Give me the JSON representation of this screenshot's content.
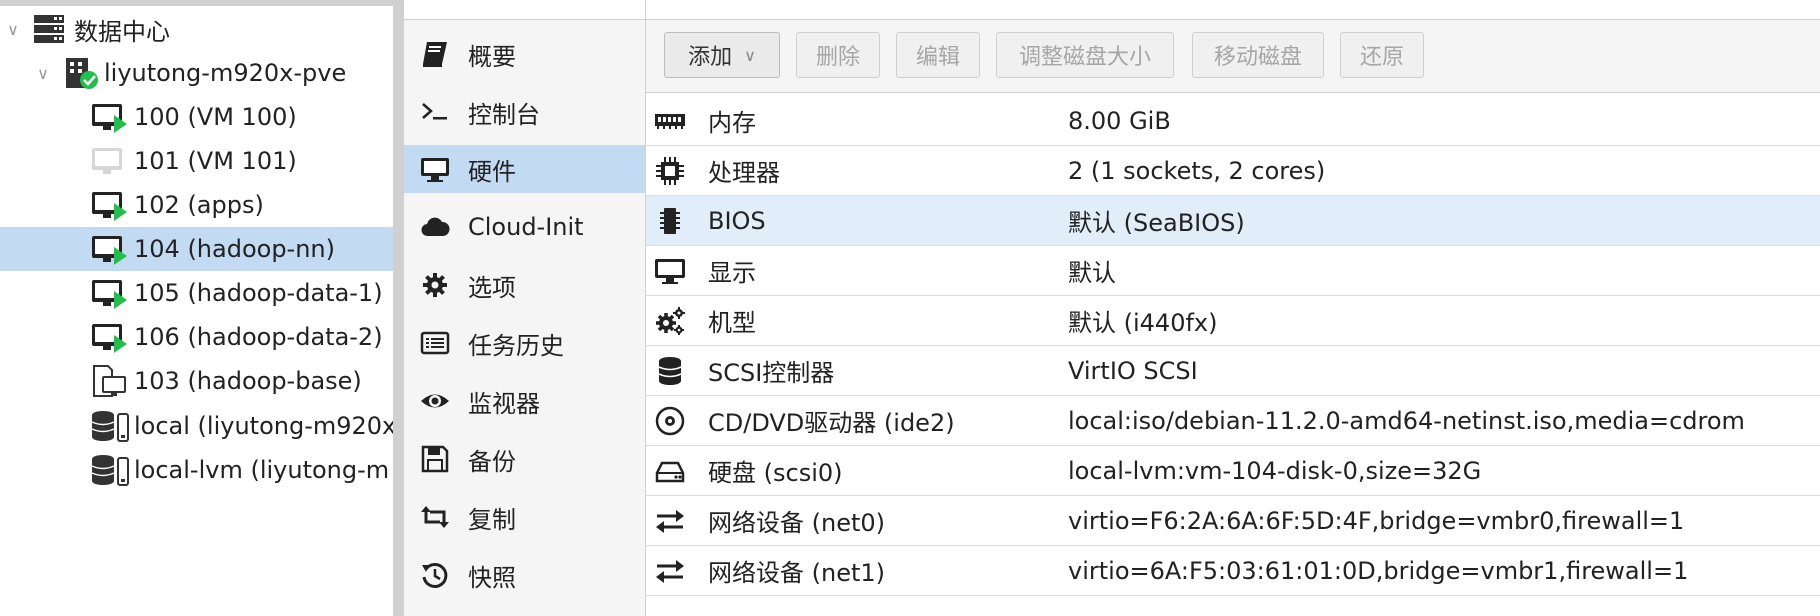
{
  "tree": {
    "items": [
      {
        "label": "数据中心",
        "icon": "datacenter-icon"
      },
      {
        "label": "liyutong-m920x-pve",
        "icon": "node-online-icon"
      },
      {
        "label": "100 (VM 100)",
        "icon": "vm-running-icon"
      },
      {
        "label": "101 (VM 101)",
        "icon": "vm-stopped-icon"
      },
      {
        "label": "102 (apps)",
        "icon": "vm-running-icon"
      },
      {
        "label": "104 (hadoop-nn)",
        "icon": "vm-running-icon"
      },
      {
        "label": "105 (hadoop-data-1)",
        "icon": "vm-running-icon"
      },
      {
        "label": "106 (hadoop-data-2)",
        "icon": "vm-running-icon"
      },
      {
        "label": "103 (hadoop-base)",
        "icon": "template-icon"
      },
      {
        "label": "local (liyutong-m920x",
        "icon": "storage-icon"
      },
      {
        "label": "local-lvm (liyutong-m",
        "icon": "storage-icon"
      }
    ]
  },
  "nav": {
    "items": [
      {
        "label": "概要",
        "icon": "book-icon"
      },
      {
        "label": "控制台",
        "icon": "terminal-icon"
      },
      {
        "label": "硬件",
        "icon": "desktop-icon"
      },
      {
        "label": "Cloud-Init",
        "icon": "cloud-icon"
      },
      {
        "label": "选项",
        "icon": "gear-icon"
      },
      {
        "label": "任务历史",
        "icon": "list-icon"
      },
      {
        "label": "监视器",
        "icon": "eye-icon"
      },
      {
        "label": "备份",
        "icon": "floppy-icon"
      },
      {
        "label": "复制",
        "icon": "retweet-icon"
      },
      {
        "label": "快照",
        "icon": "history-icon"
      }
    ]
  },
  "toolbar": {
    "add_label": "添加",
    "remove_label": "删除",
    "edit_label": "编辑",
    "resize_label": "调整磁盘大小",
    "move_label": "移动磁盘",
    "revert_label": "还原"
  },
  "hardware": {
    "rows": [
      {
        "name": "内存",
        "value": "8.00 GiB",
        "icon": "memory-icon"
      },
      {
        "name": "处理器",
        "value": "2 (1 sockets, 2 cores)",
        "icon": "cpu-icon"
      },
      {
        "name": "BIOS",
        "value": "默认 (SeaBIOS)",
        "icon": "microchip-icon"
      },
      {
        "name": "显示",
        "value": "默认",
        "icon": "desktop-icon"
      },
      {
        "name": "机型",
        "value": "默认 (i440fx)",
        "icon": "cogs-icon"
      },
      {
        "name": "SCSI控制器",
        "value": "VirtIO SCSI",
        "icon": "database-icon"
      },
      {
        "name": "CD/DVD驱动器 (ide2)",
        "value": "local:iso/debian-11.2.0-amd64-netinst.iso,media=cdrom",
        "icon": "cdrom-icon"
      },
      {
        "name": "硬盘 (scsi0)",
        "value": "local-lvm:vm-104-disk-0,size=32G",
        "icon": "hdd-icon"
      },
      {
        "name": "网络设备 (net0)",
        "value": "virtio=F6:2A:6A:6F:5D:4F,bridge=vmbr0,firewall=1",
        "icon": "exchange-icon"
      },
      {
        "name": "网络设备 (net1)",
        "value": "virtio=6A:F5:03:61:01:0D,bridge=vmbr1,firewall=1",
        "icon": "exchange-icon"
      }
    ]
  },
  "colors": {
    "selection": "#c3dbf2",
    "row_selected": "#e1edf8",
    "running_green": "#21bf4b",
    "icon_dark": "#222222",
    "disabled_text": "#a6a6a6"
  }
}
